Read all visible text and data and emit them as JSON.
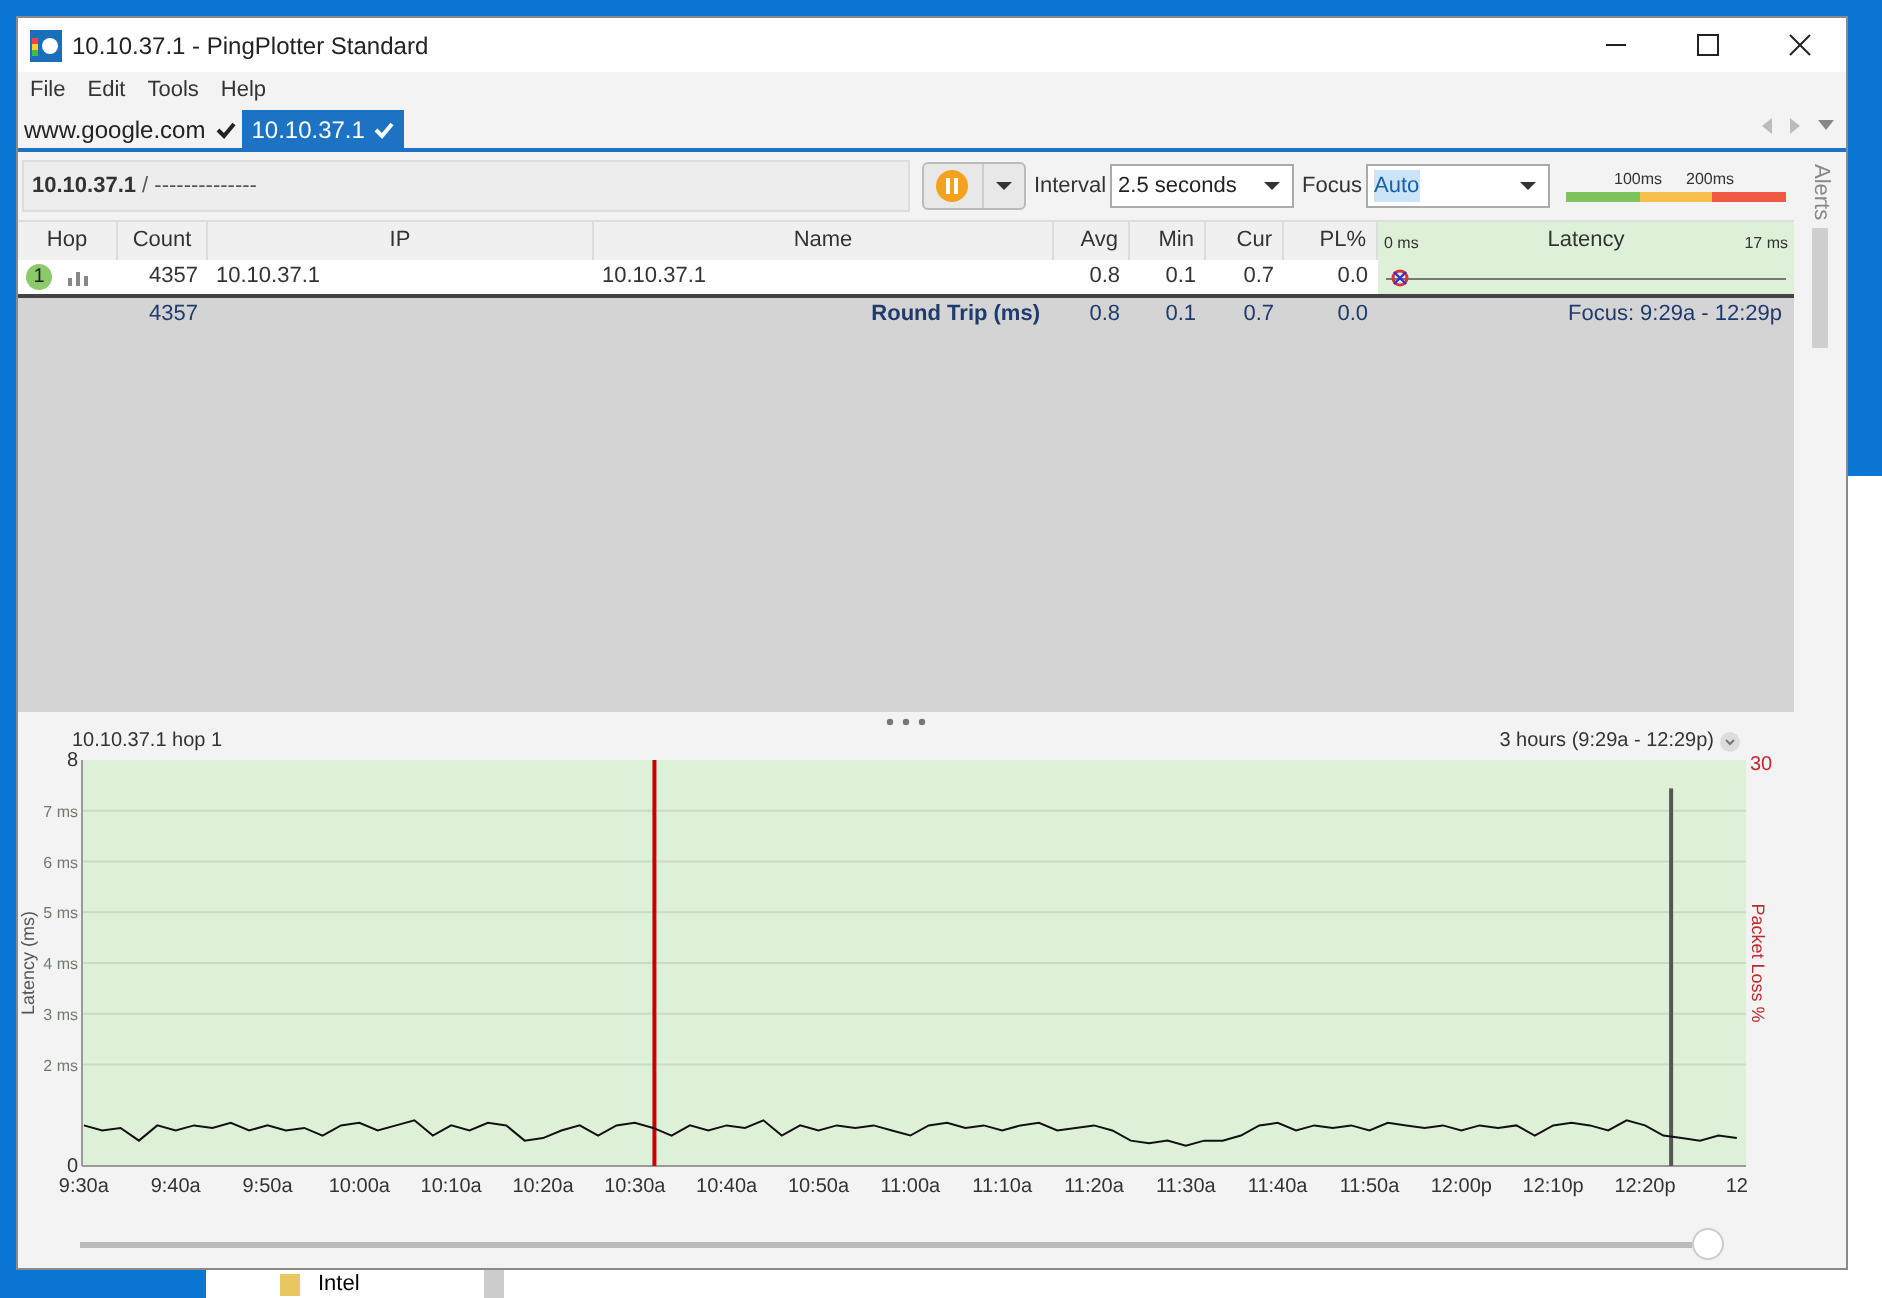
{
  "window": {
    "title": "10.10.37.1 - PingPlotter Standard"
  },
  "menu": [
    "File",
    "Edit",
    "Tools",
    "Help"
  ],
  "tabs": [
    {
      "label": "www.google.com",
      "selected": false
    },
    {
      "label": "10.10.37.1",
      "selected": true
    }
  ],
  "toolbar": {
    "target": "10.10.37.1",
    "path": " / --------------",
    "paused": true,
    "interval_label": "Interval",
    "interval": "2.5 seconds",
    "focus_label": "Focus",
    "focus": "Auto",
    "legend": [
      "100ms",
      "200ms"
    ]
  },
  "side_tab": "Alerts",
  "table": {
    "columns": [
      "Hop",
      "Count",
      "IP",
      "Name",
      "Avg",
      "Min",
      "Cur",
      "PL%"
    ],
    "latency_header": {
      "min": "0 ms",
      "title": "Latency",
      "max": "17 ms"
    },
    "rows": [
      {
        "hop": "1",
        "count": "4357",
        "ip": "10.10.37.1",
        "name": "10.10.37.1",
        "avg": "0.8",
        "min": "0.1",
        "cur": "0.7",
        "pl": "0.0",
        "level": 0.04
      }
    ],
    "summary": {
      "count": "4357",
      "label": "Round Trip (ms)",
      "avg": "0.8",
      "min": "0.1",
      "cur": "0.7",
      "pl": "0.0",
      "focus": "Focus: 9:29a - 12:29p"
    }
  },
  "graph": {
    "title": "10.10.37.1 hop 1",
    "range": "3 hours (9:29a - 12:29p)",
    "loss_axis": {
      "title": "Packet Loss %",
      "max": "30"
    },
    "loss_marker": {
      "level": 0.93
    },
    "focus_marker": {
      "level": 0.344
    },
    "chart_data": {
      "type": "line",
      "ylim": [
        0,
        8
      ],
      "grid": true,
      "categories": [
        "9:30a",
        null,
        null,
        null,
        null,
        "9:40a",
        null,
        null,
        null,
        null,
        "9:50a",
        null,
        null,
        null,
        null,
        "10:00a",
        null,
        null,
        null,
        null,
        "10:10a",
        null,
        null,
        null,
        null,
        "10:20a",
        null,
        null,
        null,
        null,
        "10:30a",
        null,
        null,
        null,
        null,
        "10:40a",
        null,
        null,
        null,
        null,
        "10:50a",
        null,
        null,
        null,
        null,
        "11:00a",
        null,
        null,
        null,
        null,
        "11:10a",
        null,
        null,
        null,
        null,
        "11:20a",
        null,
        null,
        null,
        null,
        "11:30a",
        null,
        null,
        null,
        null,
        "11:40a",
        null,
        null,
        null,
        null,
        "11:50a",
        null,
        null,
        null,
        null,
        "12:00p",
        null,
        null,
        null,
        null,
        "12:10p",
        null,
        null,
        null,
        null,
        "12:20p",
        null,
        null,
        null,
        null,
        "12"
      ],
      "series": [
        {
          "name": "Latency (ms)",
          "color": "#111111",
          "values": [
            0.8,
            0.7,
            0.75,
            0.5,
            0.8,
            0.7,
            0.8,
            0.75,
            0.85,
            0.7,
            0.8,
            0.7,
            0.75,
            0.6,
            0.8,
            0.85,
            0.7,
            0.8,
            0.9,
            0.6,
            0.8,
            0.7,
            0.85,
            0.8,
            0.5,
            0.55,
            0.7,
            0.8,
            0.6,
            0.8,
            0.85,
            0.75,
            0.6,
            0.8,
            0.7,
            0.8,
            0.75,
            0.9,
            0.6,
            0.8,
            0.7,
            0.8,
            0.75,
            0.8,
            0.7,
            0.6,
            0.8,
            0.85,
            0.75,
            0.8,
            0.7,
            0.8,
            0.85,
            0.7,
            0.75,
            0.8,
            0.7,
            0.5,
            0.45,
            0.5,
            0.4,
            0.5,
            0.5,
            0.6,
            0.8,
            0.85,
            0.7,
            0.8,
            0.75,
            0.8,
            0.7,
            0.85,
            0.8,
            0.75,
            0.8,
            0.7,
            0.8,
            0.75,
            0.8,
            0.6,
            0.8,
            0.85,
            0.8,
            0.7,
            0.9,
            0.8,
            0.6,
            0.55,
            0.5,
            0.6,
            0.55
          ]
        }
      ],
      "yticks": [
        {
          "value": 0,
          "label": "0"
        },
        {
          "value": 2,
          "label": "2 ms"
        },
        {
          "value": 3,
          "label": "3 ms"
        },
        {
          "value": 4,
          "label": "4 ms"
        },
        {
          "value": 5,
          "label": "5 ms"
        },
        {
          "value": 6,
          "label": "6 ms"
        },
        {
          "value": 7,
          "label": "7 ms"
        },
        {
          "value": 8,
          "label": "8"
        }
      ]
    },
    "slider": {
      "level": 1
    }
  },
  "background_window": {
    "items": [
      "Intel"
    ]
  }
}
